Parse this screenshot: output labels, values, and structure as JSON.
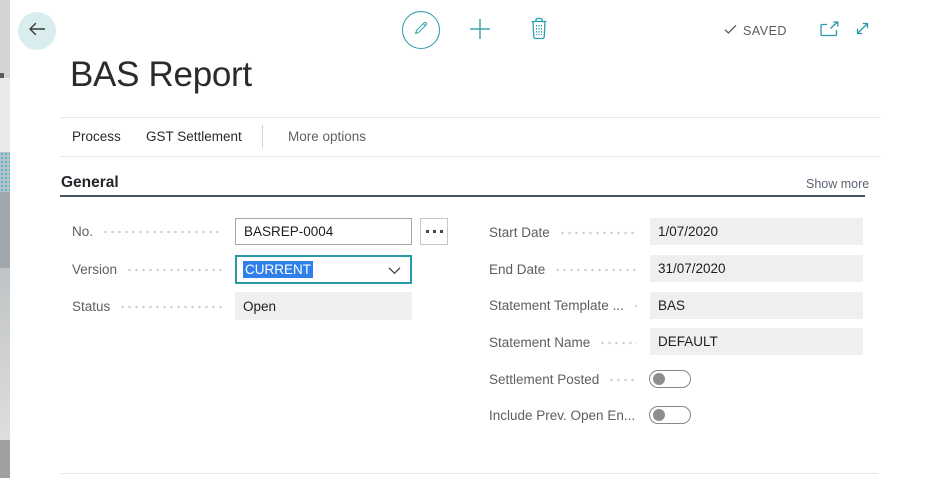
{
  "header": {
    "title": "BAS Report"
  },
  "toolbar": {
    "saved_label": "SAVED",
    "icons": [
      "back-arrow",
      "edit-pencil",
      "add-plus",
      "delete-trash",
      "saved-check",
      "open-in-new-window",
      "expand-fullscreen"
    ]
  },
  "menu": {
    "items": [
      {
        "label": "Process"
      },
      {
        "label": "GST Settlement"
      }
    ],
    "more_options": "More options"
  },
  "section": {
    "title": "General",
    "show_more": "Show more"
  },
  "fields": {
    "left": [
      {
        "label": "No.",
        "value": "BASREP-0004",
        "type": "text-input-with-assist"
      },
      {
        "label": "Version",
        "value": "CURRENT",
        "type": "combobox",
        "state": "focused-text-selected"
      },
      {
        "label": "Status",
        "value": "Open",
        "type": "readonly"
      }
    ],
    "right": [
      {
        "label": "Start Date",
        "value": "1/07/2020",
        "type": "readonly"
      },
      {
        "label": "End Date",
        "value": "31/07/2020",
        "type": "readonly"
      },
      {
        "label": "Statement Template ...",
        "value": "BAS",
        "type": "readonly"
      },
      {
        "label": "Statement Name",
        "value": "DEFAULT",
        "type": "readonly"
      },
      {
        "label": "Settlement Posted",
        "value": "off",
        "type": "toggle"
      },
      {
        "label": "Include Prev. Open En...",
        "value": "off",
        "type": "toggle"
      }
    ]
  },
  "colors": {
    "accent_teal": "#2899a6",
    "selection_blue": "#2f80e8",
    "back_circle_bg": "#d9edef",
    "readonly_bg": "#f0efee",
    "section_underline": "#455363",
    "label_grey": "#605e5c",
    "saved_grey": "#5d5b59"
  }
}
